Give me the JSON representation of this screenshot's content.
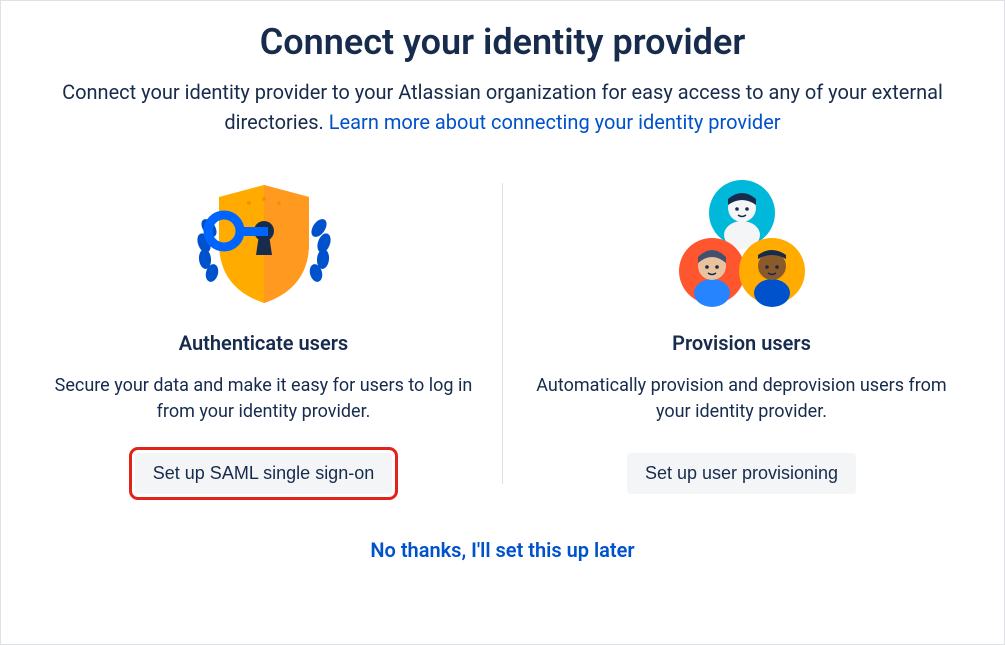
{
  "header": {
    "title": "Connect your identity provider",
    "subtitle_pre": "Connect your identity provider to your Atlassian organization for easy access to any of your external directories. ",
    "subtitle_link": "Learn more about connecting your identity provider"
  },
  "cards": {
    "authenticate": {
      "title": "Authenticate users",
      "desc": "Secure your data and make it easy for users to log in from your identity provider.",
      "button": "Set up SAML single sign-on"
    },
    "provision": {
      "title": "Provision users",
      "desc": "Automatically provision and deprovision users from your identity provider.",
      "button": "Set up user provisioning"
    }
  },
  "skip_link": "No thanks, I'll set this up later"
}
